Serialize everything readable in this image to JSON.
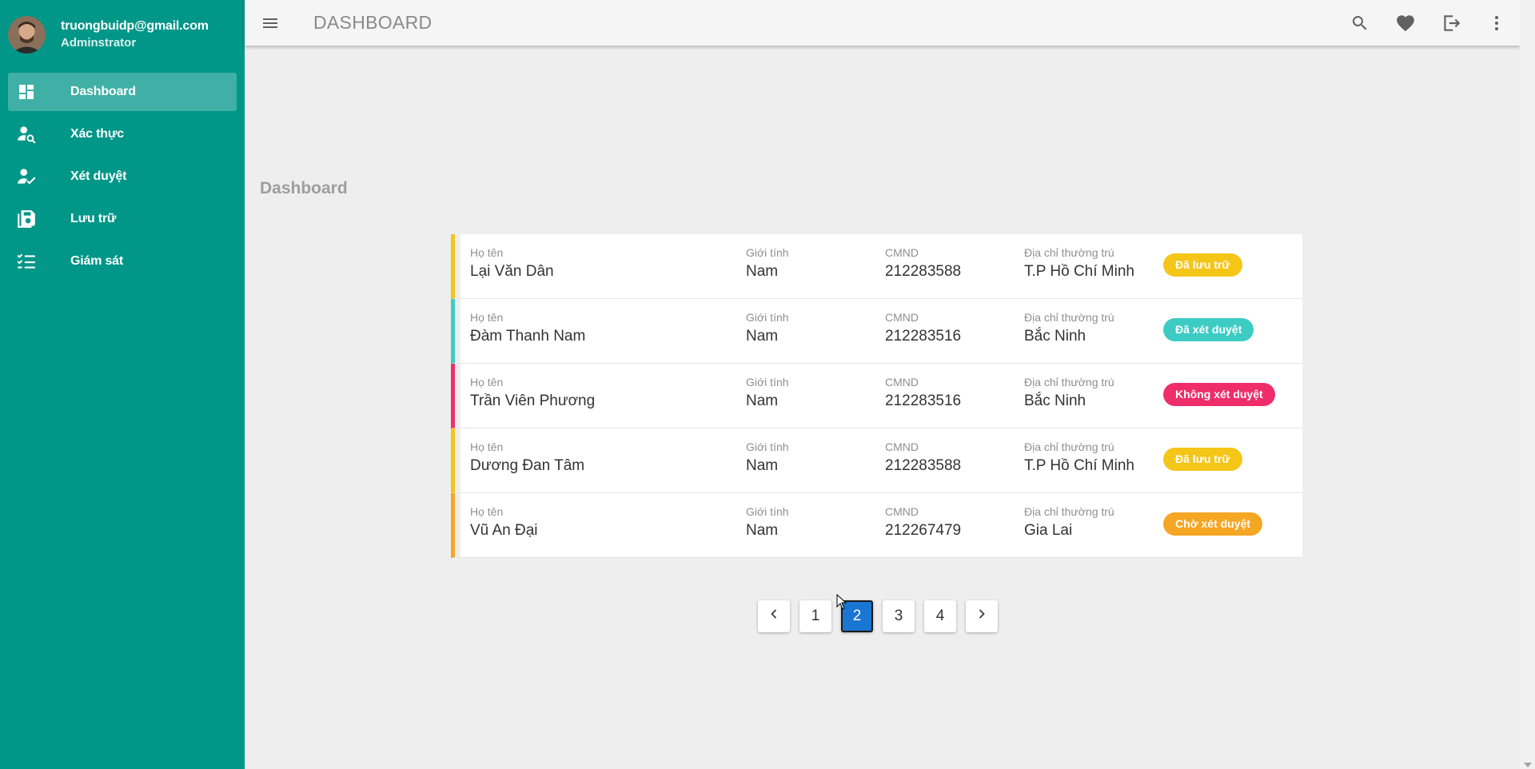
{
  "user": {
    "email": "truongbuidp@gmail.com",
    "role": "Adminstrator"
  },
  "nav": [
    {
      "label": "Dashboard",
      "icon": "dashboard-icon",
      "active": true
    },
    {
      "label": "Xác thực",
      "icon": "user-search-icon",
      "active": false
    },
    {
      "label": "Xét duyệt",
      "icon": "user-check-icon",
      "active": false
    },
    {
      "label": "Lưu trữ",
      "icon": "save-stack-icon",
      "active": false
    },
    {
      "label": "Giám sát",
      "icon": "checklist-icon",
      "active": false
    }
  ],
  "topbar": {
    "title": "DASHBOARD",
    "actions": [
      "search-icon",
      "heart-icon",
      "logout-icon",
      "more-vert-icon"
    ]
  },
  "page": {
    "heading": "Dashboard"
  },
  "columns": {
    "name": "Họ tên",
    "gender": "Giới tính",
    "id": "CMND",
    "address": "Địa chỉ thường trú"
  },
  "records": [
    {
      "name": "Lại Văn Dân",
      "gender": "Nam",
      "id": "212283588",
      "address": "T.P Hồ Chí Minh",
      "status": "Đã lưu trữ",
      "color": "#f5c518"
    },
    {
      "name": "Đàm Thanh Nam",
      "gender": "Nam",
      "id": "212283516",
      "address": "Bắc Ninh",
      "status": "Đã xét duyệt",
      "color": "#3dccc4"
    },
    {
      "name": "Trần Viên Phương",
      "gender": "Nam",
      "id": "212283516",
      "address": "Bắc Ninh",
      "status": "Không xét duyệt",
      "color": "#ef2d6b"
    },
    {
      "name": "Dương Đan Tâm",
      "gender": "Nam",
      "id": "212283588",
      "address": "T.P Hồ Chí Minh",
      "status": "Đã lưu trữ",
      "color": "#f5c518"
    },
    {
      "name": "Vũ An Đại",
      "gender": "Nam",
      "id": "212267479",
      "address": "Gia Lai",
      "status": "Chờ xét duyệt",
      "color": "#f5a623"
    }
  ],
  "pagination": {
    "pages": [
      "1",
      "2",
      "3",
      "4"
    ],
    "current": "2"
  },
  "colors": {
    "sidebar": "#009688",
    "active_page": "#1976d2"
  }
}
